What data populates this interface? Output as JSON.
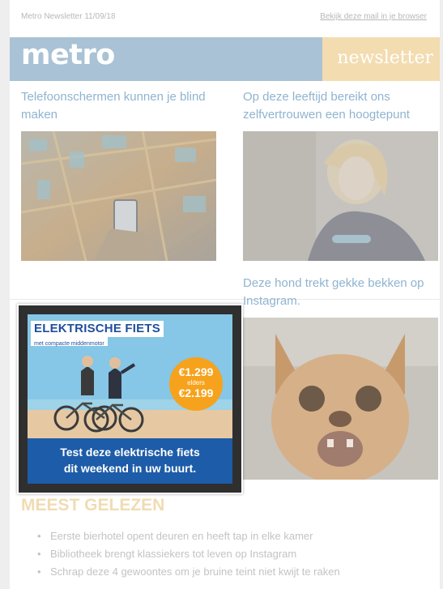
{
  "topbar": {
    "date": "Metro Newsletter 11/09/18",
    "browser_link": "Bekijk deze mail in je browser"
  },
  "header": {
    "logo": "metro",
    "tag": "newsletter",
    "colors": {
      "blue": "#a9c2d5",
      "yellow": "#f3dcb0"
    }
  },
  "articles": [
    {
      "title": "Telefoonschermen kunnen je blind maken",
      "image": "aerial-city-night-phone-photo"
    },
    {
      "title": "Op deze leeftijd bereikt ons zelfvertrouwen een hoogtepunt",
      "image": "woman-smiling-photo"
    },
    {
      "title": "Deze hond trekt gekke bekken op Instagram.",
      "image": "dog-funny-face-photo"
    }
  ],
  "ad": {
    "title": "ELEKTRISCHE FIETS",
    "subtitle": "met compacte middenmotor",
    "price_new": "€1.299",
    "price_label": "elders",
    "price_old": "€2.199",
    "banner_line1": "Test deze elektrische fiets",
    "banner_line2": "dit weekend in uw buurt.",
    "colors": {
      "brand": "#1d5ca8",
      "badge": "#f6a21c",
      "sky": "#7fc2e4"
    }
  },
  "most_read": {
    "heading": "MEEST GELEZEN",
    "items": [
      "Eerste bierhotel opent deuren en heeft tap in elke kamer",
      "Bibliotheek brengt klassiekers tot leven op Instagram",
      "Schrap deze 4 gewoontes om je bruine teint niet kwijt te raken"
    ]
  }
}
